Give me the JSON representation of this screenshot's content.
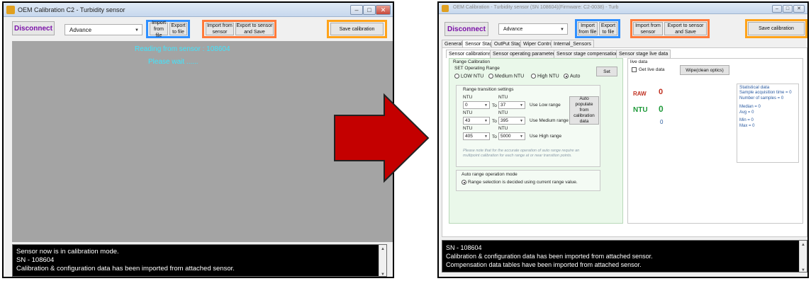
{
  "left": {
    "title": "OEM Calibration C2 - Turbidity sensor",
    "window_buttons": [
      "–",
      "□",
      "✕"
    ],
    "disconnect": "Disconnect",
    "mode": "Advance",
    "import_file": "Import from file",
    "export_file": "Export to file",
    "import_sensor": "Import from sensor",
    "export_sensor": "Export to sensor and Save",
    "save_calibration": "Save calibration",
    "reading": "Reading from sensor : 108604",
    "wait": "Please wait ......",
    "console_lines": [
      "Sensor now is in calibration mode.",
      "SN - 108604",
      "Calibration & configuration data has been imported from attached sensor."
    ]
  },
  "right": {
    "title": "OEM Calibration - Turbidity sensor (SN 108604)(Firmware: C2-0038) - Turb",
    "window_buttons": [
      "–",
      "□",
      "✕"
    ],
    "disconnect": "Disconnect",
    "mode": "Advance",
    "import_file": "Import from file",
    "export_file": "Export to file",
    "import_sensor": "Import from sensor",
    "export_sensor": "Export to sensor and Save",
    "save_calibration": "Save calibration",
    "main_tabs": [
      "General",
      "Sensor Stage",
      "OutPut Stage",
      "Wiper Controll",
      "Internal_Sensors"
    ],
    "sub_tabs": [
      "Sensor calibrations",
      "Sensor operating parameters",
      "Sensor stage compensations",
      "Sensor stage live data"
    ],
    "range_calibration": "Range Calibration",
    "set_operating_range": "SET Operating Range",
    "set_button": "Set",
    "radios": [
      "LOW NTU",
      "Medium NTU",
      "High NTU",
      "Auto"
    ],
    "transition_title": "Range transition settings",
    "ntu": "NTU",
    "to": "To",
    "rows": [
      {
        "from": "0",
        "to": "37",
        "label": "Use Low range"
      },
      {
        "from": "43",
        "to": "395",
        "label": "Use Medium range"
      },
      {
        "from": "405",
        "to": "5000",
        "label": "Use High range"
      }
    ],
    "auto_populate": "Auto populate from calibration data",
    "note": "Please note that for the accurate operation of auto range require an multipoint calibration for each range at or near transition points.",
    "auto_mode_title": "Auto range operation mode",
    "auto_mode_option": "Range selection is decided using current range value.",
    "live_data": "live data",
    "get_live": "Get live data",
    "wipe": "Wipe(clean optics)",
    "raw_label": "RAW",
    "raw_value": "0",
    "ntu_label": "NTU",
    "ntu_value": "0",
    "ntu_value2": "0",
    "stats_title": "Statistical data",
    "stats": [
      "Sample acquisition time = 0",
      "Number of samples = 0",
      "Median = 0",
      "Avg = 0",
      "Min = 0",
      "Max = 0"
    ],
    "console_lines": [
      "SN - 108604",
      "Calibration & configuration data has been imported from attached sensor.",
      "Compensation data tables have been imported from attached sensor."
    ]
  },
  "colors": {
    "blue_group": "#2f8fff",
    "orange_group": "#ff7a3a",
    "save_group": "#ffa31a",
    "arrow_red": "#c40000"
  }
}
